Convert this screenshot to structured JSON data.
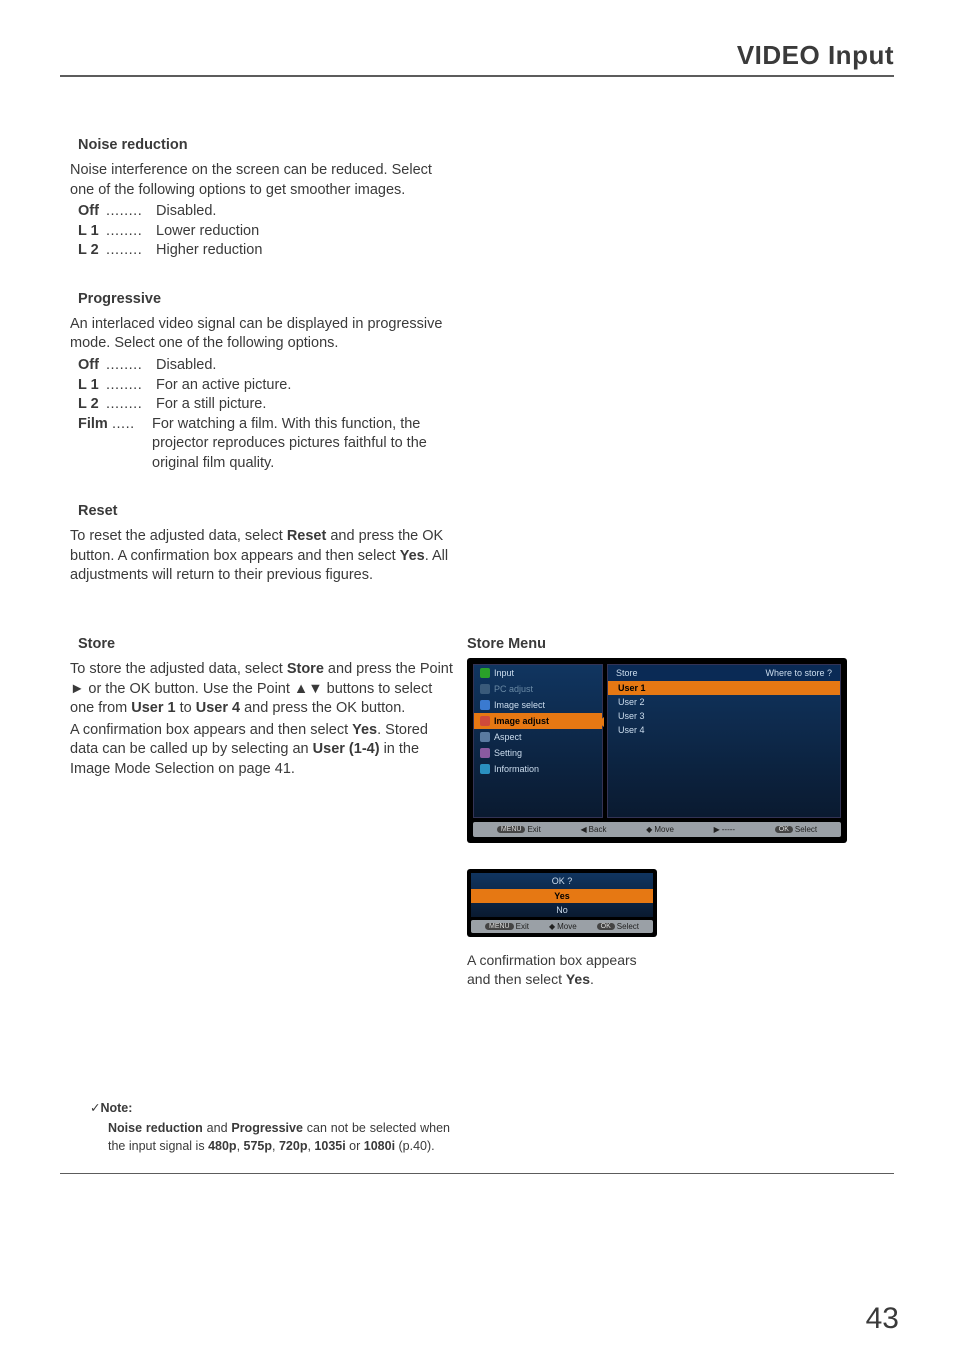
{
  "header": {
    "title": "VIDEO Input"
  },
  "noise": {
    "title": "Noise reduction",
    "intro": "Noise interference on the screen can be reduced. Select one of the following options to get smoother images.",
    "opts": [
      {
        "k": "Off",
        "d": "........",
        "v": "Disabled."
      },
      {
        "k": "L 1",
        "d": "........",
        "v": "Lower reduction"
      },
      {
        "k": "L 2",
        "d": "........",
        "v": "Higher reduction"
      }
    ]
  },
  "prog": {
    "title": "Progressive",
    "intro": "An interlaced video signal can be displayed in progressive mode. Select one of the following options.",
    "opts": [
      {
        "k": "Off",
        "d": "........",
        "v": "Disabled."
      },
      {
        "k": "L 1",
        "d": "........",
        "v": "For an active picture."
      },
      {
        "k": "L 2",
        "d": "........",
        "v": "For a still picture."
      },
      {
        "k": "Film",
        "d": ".....",
        "v": "For watching a film. With this function, the projector reproduces pictures faithful to the original film quality."
      }
    ]
  },
  "reset": {
    "title": "Reset",
    "body_pre": "To reset the adjusted data, select ",
    "body_bold1": "Reset",
    "body_mid": " and press the OK button. A confirmation box appears and then select ",
    "body_bold2": "Yes",
    "body_post": ". All adjustments will return to their previous figures."
  },
  "store": {
    "title": "Store",
    "p1a": "To store the adjusted data, select ",
    "p1b": "Store",
    "p1c": " and press the Point ► or the OK button. Use the Point ▲▼ buttons to select one from ",
    "p1d": "User 1",
    "p1e": " to ",
    "p1f": "User 4",
    "p1g": " and press the OK button.",
    "p2a": "A confirmation box appears and then select ",
    "p2b": "Yes",
    "p2c": ". Stored data can be called up by selecting an ",
    "p2d": "User (1-4)",
    "p2e": " in the Image Mode Selection on page 41."
  },
  "storemenu": {
    "title": "Store Menu",
    "side": [
      {
        "label": "Input",
        "color": "#2aa02a",
        "dim": false,
        "hl": false
      },
      {
        "label": "PC adjust",
        "color": "#6a8aa5",
        "dim": true,
        "hl": false
      },
      {
        "label": "Image select",
        "color": "#3a7ad0",
        "dim": false,
        "hl": false
      },
      {
        "label": "Image adjust",
        "color": "#d04a3a",
        "dim": false,
        "hl": true
      },
      {
        "label": "Aspect",
        "color": "#5a7aa0",
        "dim": false,
        "hl": false
      },
      {
        "label": "Setting",
        "color": "#8a5aa0",
        "dim": false,
        "hl": false
      },
      {
        "label": "Information",
        "color": "#2a90c0",
        "dim": false,
        "hl": false
      }
    ],
    "main_head_left": "Store",
    "main_head_right": "Where to store ?",
    "main_rows": [
      {
        "label": "User 1",
        "hl": true
      },
      {
        "label": "User 2",
        "hl": false
      },
      {
        "label": "User 3",
        "hl": false
      },
      {
        "label": "User 4",
        "hl": false
      }
    ],
    "foot": [
      {
        "icon": "MENU",
        "label": "Exit"
      },
      {
        "icon": "◀",
        "label": "Back"
      },
      {
        "icon": "◆",
        "label": "Move"
      },
      {
        "icon": "▶",
        "label": "-----"
      },
      {
        "icon": "OK",
        "label": "Select"
      }
    ]
  },
  "confirm": {
    "title": "OK ?",
    "opts": [
      {
        "label": "Yes",
        "hl": true
      },
      {
        "label": "No",
        "hl": false
      }
    ],
    "foot": [
      {
        "icon": "MENU",
        "label": "Exit"
      },
      {
        "icon": "◆",
        "label": "Move"
      },
      {
        "icon": "OK",
        "label": "Select"
      }
    ],
    "caption_a": "A confirmation box appears and then select ",
    "caption_b": "Yes",
    "caption_c": "."
  },
  "note": {
    "check": "✓",
    "label": "Note:",
    "b1": "Noise reduction",
    "t1": " and ",
    "b2": "Progressive",
    "t2": " can not be selected when the input signal is ",
    "b3": "480p",
    "t3": ", ",
    "b4": "575p",
    "t4": ", ",
    "b5": "720p",
    "t5": ", ",
    "b6": "1035i",
    "t6": " or ",
    "b7": "1080i",
    "t7": " (p.40)."
  },
  "page_number": "43"
}
